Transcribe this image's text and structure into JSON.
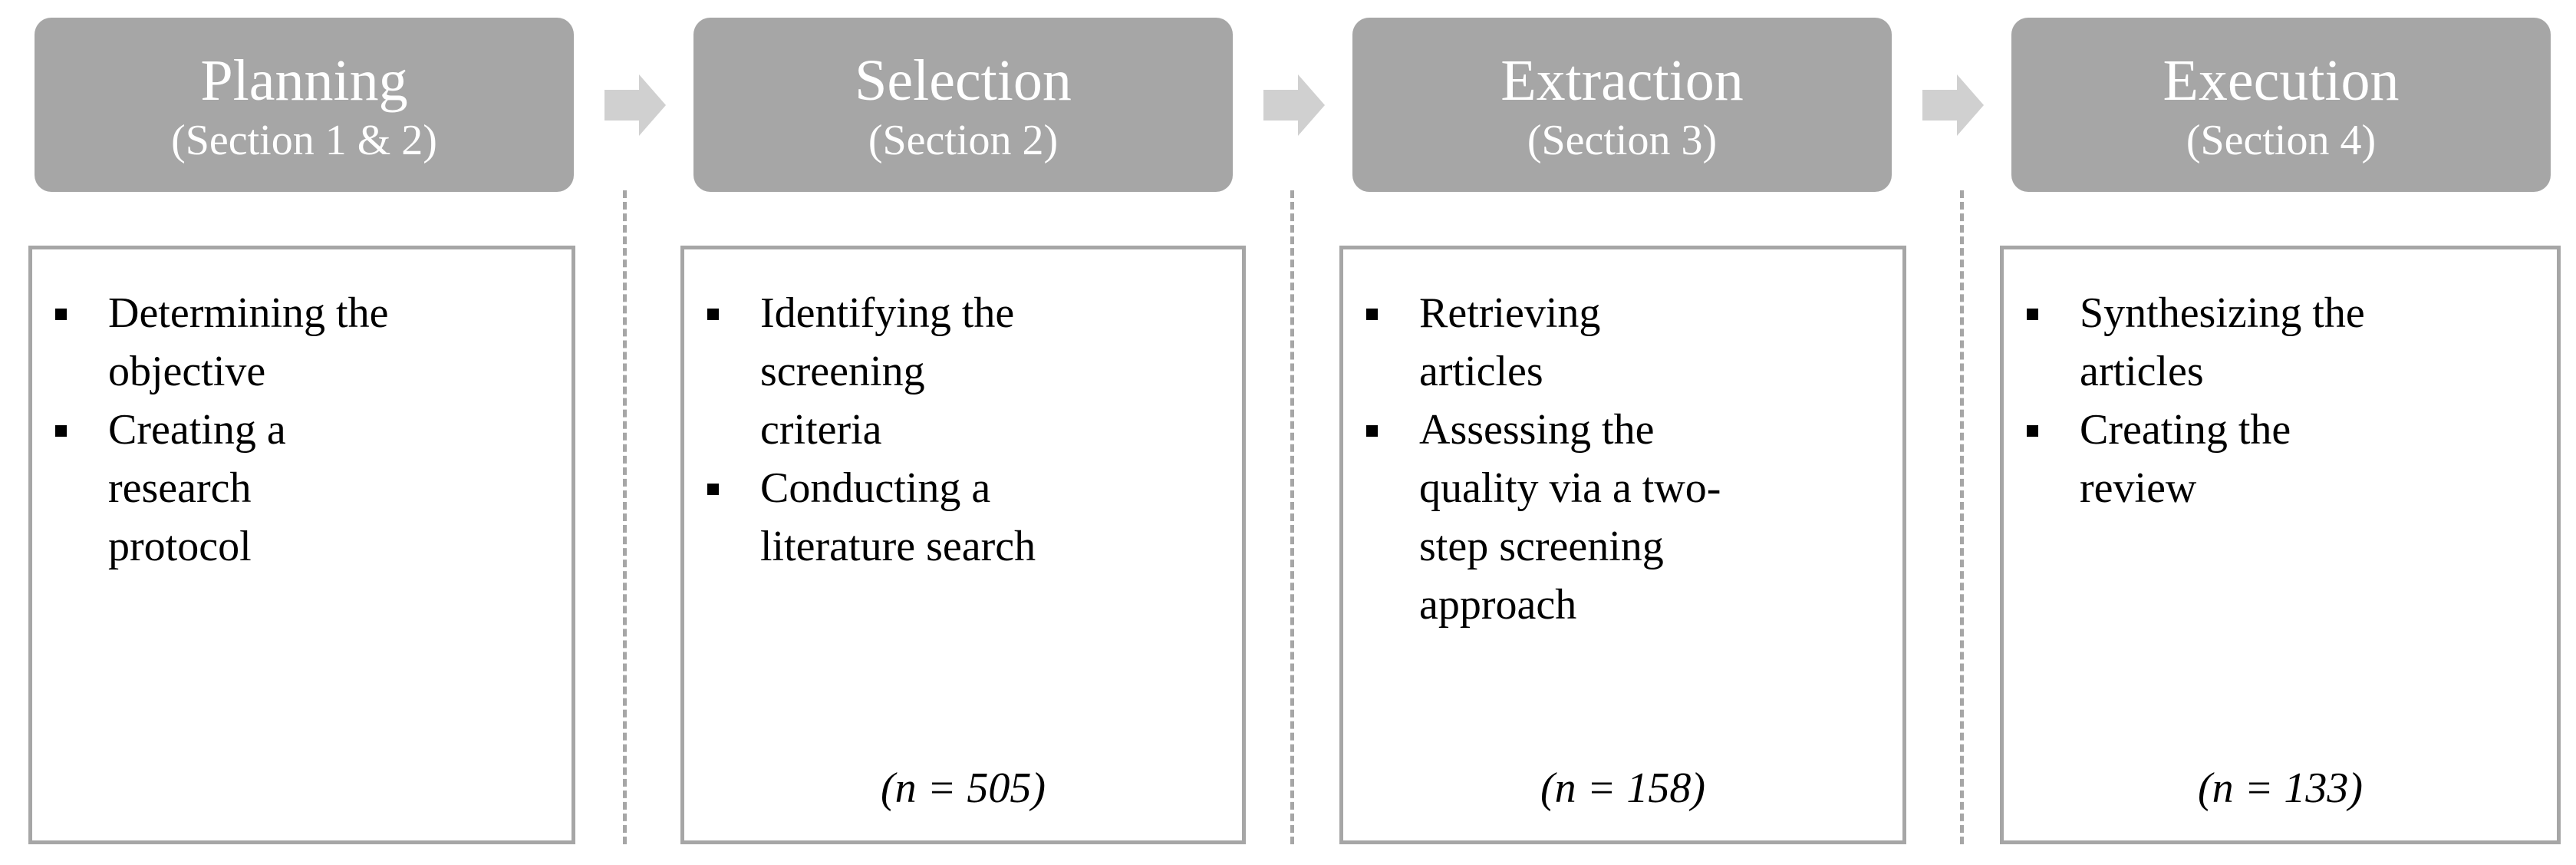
{
  "colors": {
    "header_fill": "#a6a6a6",
    "arrow": "#d0d0d0",
    "border": "#a6a6a6"
  },
  "stages": [
    {
      "title": "Planning",
      "section": "(Section 1 & 2)",
      "items": [
        "Determining the objective",
        "Creating a research protocol"
      ],
      "n": ""
    },
    {
      "title": "Selection",
      "section": "(Section 2)",
      "items": [
        "Identifying the screening criteria",
        "Conducting a literature search"
      ],
      "n": "(n = 505)"
    },
    {
      "title": "Extraction",
      "section": "(Section 3)",
      "items": [
        "Retrieving articles",
        "Assessing the quality via a two-step screening approach"
      ],
      "n": "(n = 158)"
    },
    {
      "title": "Execution",
      "section": "(Section 4)",
      "items": [
        "Synthesizing the articles",
        "Creating the review"
      ],
      "n": "(n = 133)"
    }
  ]
}
